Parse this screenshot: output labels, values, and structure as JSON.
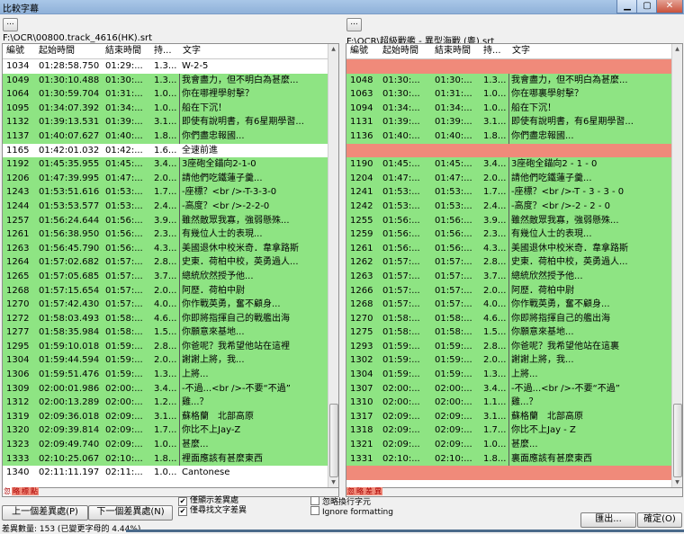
{
  "window": {
    "title": "比較字幕",
    "min_glyph": "▁",
    "max_glyph": "▢",
    "close_glyph": "✕"
  },
  "colors": {
    "diff_green": "#8ee483",
    "missing_red": "#f08a7a"
  },
  "left": {
    "browse_label": "...",
    "path": "F:\\OCR\\00800.track_4616(HK).srt",
    "columns": [
      "編號",
      "起始時間",
      "結束時間",
      "持...",
      "文字"
    ],
    "rows": [
      {
        "s": "w",
        "n": "1034",
        "a": "01:28:58.750",
        "b": "01:29:...",
        "d": "1.3...",
        "t": "W-2-5"
      },
      {
        "s": "g",
        "n": "1049",
        "a": "01:30:10.488",
        "b": "01:30:...",
        "d": "1.3...",
        "t": "我會盡力，但不明白為甚麼..."
      },
      {
        "s": "g",
        "n": "1064",
        "a": "01:30:59.704",
        "b": "01:31:...",
        "d": "1.0...",
        "t": "你在哪裡學射擊？"
      },
      {
        "s": "g",
        "n": "1095",
        "a": "01:34:07.392",
        "b": "01:34:...",
        "d": "1.0...",
        "t": "船在下沉！"
      },
      {
        "s": "g",
        "n": "1132",
        "a": "01:39:13.531",
        "b": "01:39:...",
        "d": "3.1...",
        "t": "即使有說明書，有6星期學習..."
      },
      {
        "s": "g",
        "n": "1137",
        "a": "01:40:07.627",
        "b": "01:40:...",
        "d": "1.8...",
        "t": "你們盡忠報國..."
      },
      {
        "s": "w",
        "n": "1165",
        "a": "01:42:01.032",
        "b": "01:42:...",
        "d": "1.6...",
        "t": "全速前進"
      },
      {
        "s": "g",
        "n": "1192",
        "a": "01:45:35.955",
        "b": "01:45:...",
        "d": "3.4...",
        "t": "3座砲全錨向2-1-0"
      },
      {
        "s": "g",
        "n": "1206",
        "a": "01:47:39.995",
        "b": "01:47:...",
        "d": "2.0...",
        "t": "請他們吃鐵蓮子羹..."
      },
      {
        "s": "g",
        "n": "1243",
        "a": "01:53:51.616",
        "b": "01:53:...",
        "d": "1.7...",
        "t": "-座標？<br />-T-3-3-0"
      },
      {
        "s": "g",
        "n": "1244",
        "a": "01:53:53.577",
        "b": "01:53:...",
        "d": "2.4...",
        "t": "-高度？<br />-2-2-0"
      },
      {
        "s": "g",
        "n": "1257",
        "a": "01:56:24.644",
        "b": "01:56:...",
        "d": "3.9...",
        "t": "雖然敵眾我寡，強弱懸殊..."
      },
      {
        "s": "g",
        "n": "1261",
        "a": "01:56:38.950",
        "b": "01:56:...",
        "d": "2.3...",
        "t": "有幾位人士的表現..."
      },
      {
        "s": "g",
        "n": "1263",
        "a": "01:56:45.790",
        "b": "01:56:...",
        "d": "4.3...",
        "t": "美國退休中校米奇．韋拿路斯"
      },
      {
        "s": "g",
        "n": "1264",
        "a": "01:57:02.682",
        "b": "01:57:...",
        "d": "2.8...",
        "t": "史東．荷柏中校，英勇過人..."
      },
      {
        "s": "g",
        "n": "1265",
        "a": "01:57:05.685",
        "b": "01:57:...",
        "d": "3.7...",
        "t": "總統欣然授予他..."
      },
      {
        "s": "g",
        "n": "1268",
        "a": "01:57:15.654",
        "b": "01:57:...",
        "d": "2.0...",
        "t": "阿歷．荷柏中尉"
      },
      {
        "s": "g",
        "n": "1270",
        "a": "01:57:42.430",
        "b": "01:57:...",
        "d": "4.0...",
        "t": "你作戰英勇，奮不顧身..."
      },
      {
        "s": "g",
        "n": "1272",
        "a": "01:58:03.493",
        "b": "01:58:...",
        "d": "4.6...",
        "t": "你即將指揮自己的戰艦出海"
      },
      {
        "s": "g",
        "n": "1277",
        "a": "01:58:35.984",
        "b": "01:58:...",
        "d": "1.5...",
        "t": "你願意來基地..."
      },
      {
        "s": "g",
        "n": "1295",
        "a": "01:59:10.018",
        "b": "01:59:...",
        "d": "2.8...",
        "t": "你爸呢？我希望他站在這裡"
      },
      {
        "s": "g",
        "n": "1304",
        "a": "01:59:44.594",
        "b": "01:59:...",
        "d": "2.0...",
        "t": "謝謝上將，我..."
      },
      {
        "s": "g",
        "n": "1306",
        "a": "01:59:51.476",
        "b": "01:59:...",
        "d": "1.3...",
        "t": "上將..."
      },
      {
        "s": "g",
        "n": "1309",
        "a": "02:00:01.986",
        "b": "02:00:...",
        "d": "3.4...",
        "t": "-不過...<br />-不要“不過”"
      },
      {
        "s": "g",
        "n": "1312",
        "a": "02:00:13.289",
        "b": "02:00:...",
        "d": "1.2...",
        "t": "雞...？"
      },
      {
        "s": "g",
        "n": "1319",
        "a": "02:09:36.018",
        "b": "02:09:...",
        "d": "3.1...",
        "t": "蘇格蘭　北部高原"
      },
      {
        "s": "g",
        "n": "1320",
        "a": "02:09:39.814",
        "b": "02:09:...",
        "d": "1.7...",
        "t": "你比不上Jay-Z"
      },
      {
        "s": "g",
        "n": "1323",
        "a": "02:09:49.740",
        "b": "02:09:...",
        "d": "1.0...",
        "t": "甚麼..."
      },
      {
        "s": "g",
        "n": "1333",
        "a": "02:10:25.067",
        "b": "02:10:...",
        "d": "1.8...",
        "t": "裡面應該有甚麼東西"
      },
      {
        "s": "w",
        "n": "1340",
        "a": "02:11:11.197",
        "b": "02:11:...",
        "d": "1.0...",
        "t": "Cantonese"
      }
    ],
    "legend": [
      "忽",
      "略",
      "標",
      "點"
    ]
  },
  "right": {
    "browse_label": "...",
    "path": "F:\\OCR\\超級戰艦 - 異型海戰 (粵).srt",
    "columns": [
      "編號",
      "起始時間",
      "結束時間",
      "持...",
      "文字"
    ],
    "rows": [
      {
        "s": "r",
        "n": "",
        "a": "",
        "b": "",
        "d": "",
        "t": ""
      },
      {
        "s": "g",
        "n": "1048",
        "a": "01:30:...",
        "b": "01:30:...",
        "d": "1.3...",
        "t": "我會盡力，但不明白為甚麼..."
      },
      {
        "s": "g",
        "n": "1063",
        "a": "01:30:...",
        "b": "01:31:...",
        "d": "1.0...",
        "t": "你在哪裏學射擊？"
      },
      {
        "s": "g",
        "n": "1094",
        "a": "01:34:...",
        "b": "01:34:...",
        "d": "1.0...",
        "t": "船在下沉！"
      },
      {
        "s": "g",
        "n": "1131",
        "a": "01:39:...",
        "b": "01:39:...",
        "d": "3.1...",
        "t": "即使有說明書，有6星期學習..."
      },
      {
        "s": "g",
        "n": "1136",
        "a": "01:40:...",
        "b": "01:40:...",
        "d": "1.8...",
        "t": "你們盡忠報國..."
      },
      {
        "s": "r",
        "n": "",
        "a": "",
        "b": "",
        "d": "",
        "t": ""
      },
      {
        "s": "g",
        "n": "1190",
        "a": "01:45:...",
        "b": "01:45:...",
        "d": "3.4...",
        "t": "3座砲全錨向2 - 1 - 0"
      },
      {
        "s": "g",
        "n": "1204",
        "a": "01:47:...",
        "b": "01:47:...",
        "d": "2.0...",
        "t": "請他們吃鐵蓮子羹..."
      },
      {
        "s": "g",
        "n": "1241",
        "a": "01:53:...",
        "b": "01:53:...",
        "d": "1.7...",
        "t": "-座標？<br />-T - 3 - 3 - 0"
      },
      {
        "s": "g",
        "n": "1242",
        "a": "01:53:...",
        "b": "01:53:...",
        "d": "2.4...",
        "t": "-高度？<br />-2 - 2 - 0"
      },
      {
        "s": "g",
        "n": "1255",
        "a": "01:56:...",
        "b": "01:56:...",
        "d": "3.9...",
        "t": "雖然敵眾我寡，強弱懸殊..."
      },
      {
        "s": "g",
        "n": "1259",
        "a": "01:56:...",
        "b": "01:56:...",
        "d": "2.3...",
        "t": "有幾位人士的表現..."
      },
      {
        "s": "g",
        "n": "1261",
        "a": "01:56:...",
        "b": "01:56:...",
        "d": "4.3...",
        "t": "美國退休中校米奇．韋拿路斯"
      },
      {
        "s": "g",
        "n": "1262",
        "a": "01:57:...",
        "b": "01:57:...",
        "d": "2.8...",
        "t": "史東．荷柏中校，英勇過人..."
      },
      {
        "s": "g",
        "n": "1263",
        "a": "01:57:...",
        "b": "01:57:...",
        "d": "3.7...",
        "t": "總統欣然授予他..."
      },
      {
        "s": "g",
        "n": "1266",
        "a": "01:57:...",
        "b": "01:57:...",
        "d": "2.0...",
        "t": "阿歷．荷柏中尉"
      },
      {
        "s": "g",
        "n": "1268",
        "a": "01:57:...",
        "b": "01:57:...",
        "d": "4.0...",
        "t": "你作戰英勇，奮不顧身..."
      },
      {
        "s": "g",
        "n": "1270",
        "a": "01:58:...",
        "b": "01:58:...",
        "d": "4.6...",
        "t": "你即將指揮自己的艦出海"
      },
      {
        "s": "g",
        "n": "1275",
        "a": "01:58:...",
        "b": "01:58:...",
        "d": "1.5...",
        "t": "你願意來基地..."
      },
      {
        "s": "g",
        "n": "1293",
        "a": "01:59:...",
        "b": "01:59:...",
        "d": "2.8...",
        "t": "你爸呢？我希望他站在這裏"
      },
      {
        "s": "g",
        "n": "1302",
        "a": "01:59:...",
        "b": "01:59:...",
        "d": "2.0...",
        "t": "謝謝上將，我..."
      },
      {
        "s": "g",
        "n": "1304",
        "a": "01:59:...",
        "b": "01:59:...",
        "d": "1.3...",
        "t": "上將..."
      },
      {
        "s": "g",
        "n": "1307",
        "a": "02:00:...",
        "b": "02:00:...",
        "d": "3.4...",
        "t": "-不過...<br />-不要“不過”"
      },
      {
        "s": "g",
        "n": "1310",
        "a": "02:00:...",
        "b": "02:00:...",
        "d": "1.1...",
        "t": "雞...？"
      },
      {
        "s": "g",
        "n": "1317",
        "a": "02:09:...",
        "b": "02:09:...",
        "d": "3.1...",
        "t": "蘇格蘭　北部高原"
      },
      {
        "s": "g",
        "n": "1318",
        "a": "02:09:...",
        "b": "02:09:...",
        "d": "1.7...",
        "t": "你比不上Jay - Z"
      },
      {
        "s": "g",
        "n": "1321",
        "a": "02:09:...",
        "b": "02:09:...",
        "d": "1.0...",
        "t": "甚麼..."
      },
      {
        "s": "g",
        "n": "1331",
        "a": "02:10:...",
        "b": "02:10:...",
        "d": "1.8...",
        "t": "裏面應該有甚麼東西"
      },
      {
        "s": "r",
        "n": "",
        "a": "",
        "b": "",
        "d": "",
        "t": ""
      }
    ],
    "legend": [
      "忽",
      "略",
      "差",
      "異"
    ]
  },
  "bottom": {
    "prev_diff": "上一個差異處(P)",
    "next_diff": "下一個差異處(N)",
    "only_diff_label": "僅顯示差異處",
    "only_text_diff_label": "僅尋找文字差異",
    "ignore_whitespace_label": "忽略換行字元",
    "ignore_formatting_label": "Ignore formatting",
    "check_glyph": "✔",
    "export_label": "匯出...",
    "ok_label": "確定(O)",
    "status": "差異數量: 153 (已變更字母的 4.44%)"
  }
}
